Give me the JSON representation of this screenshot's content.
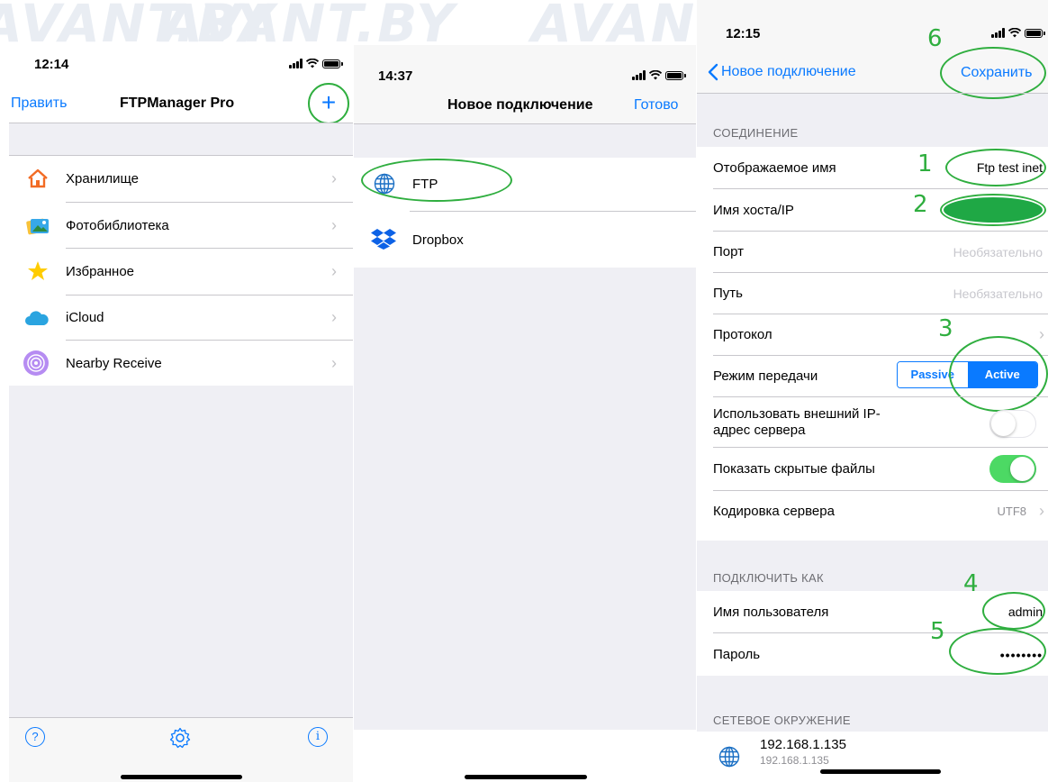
{
  "watermark": [
    "AVANT.BY",
    "AVANT.BY",
    "AVAN"
  ],
  "left": {
    "time": "12:14",
    "nav": {
      "edit": "Править",
      "title": "FTPManager Pro",
      "add": "+"
    },
    "items": [
      {
        "label": "Хранилище",
        "icon": "home-icon"
      },
      {
        "label": "Фотобиблиотека",
        "icon": "photos-icon"
      },
      {
        "label": "Избранное",
        "icon": "star-icon"
      },
      {
        "label": "iCloud",
        "icon": "cloud-icon"
      },
      {
        "label": "Nearby Receive",
        "icon": "airdrop-icon"
      }
    ],
    "toolbar": {
      "help": "?",
      "info": "i"
    }
  },
  "middle": {
    "time": "14:37",
    "nav": {
      "title": "Новое подключение",
      "done": "Готово"
    },
    "items": [
      {
        "label": "FTP",
        "icon": "globe-icon"
      },
      {
        "label": "Dropbox",
        "icon": "dropbox-icon"
      }
    ]
  },
  "right": {
    "time": "12:15",
    "nav": {
      "back": "Новое подключение",
      "save": "Сохранить"
    },
    "section_connection": "СОЕДИНЕНИЕ",
    "display_name": {
      "label": "Отображаемое имя",
      "value": "Ftp test inet"
    },
    "host": {
      "label": "Имя хоста/IP"
    },
    "port": {
      "label": "Порт",
      "placeholder": "Необязательно"
    },
    "path": {
      "label": "Путь",
      "placeholder": "Необязательно"
    },
    "protocol": {
      "label": "Протокол"
    },
    "transfer_mode": {
      "label": "Режим передачи",
      "options": [
        "Passive",
        "Active"
      ],
      "selected": "Active"
    },
    "external_ip": {
      "label_line1": "Использовать внешний IP-",
      "label_line2": "адрес сервера",
      "on": false
    },
    "hidden_files": {
      "label": "Показать скрытые файлы",
      "on": true
    },
    "encoding": {
      "label": "Кодировка сервера",
      "value": "UTF8"
    },
    "section_login": "ПОДКЛЮЧИТЬ КАК",
    "username": {
      "label": "Имя пользователя",
      "value": "admin"
    },
    "password": {
      "label": "Пароль",
      "value": "••••••••"
    },
    "section_network": "СЕТЕВОЕ ОКРУЖЕНИЕ",
    "network_item": {
      "title": "192.168.1.135",
      "subtitle": "192.168.1.135"
    }
  },
  "annotations": [
    "1",
    "2",
    "3",
    "4",
    "5",
    "6"
  ],
  "colors": {
    "accent": "#0a7aff",
    "annotation": "#2fae3f",
    "toggle_on": "#4cd964",
    "grouped_bg": "#efeff4"
  }
}
